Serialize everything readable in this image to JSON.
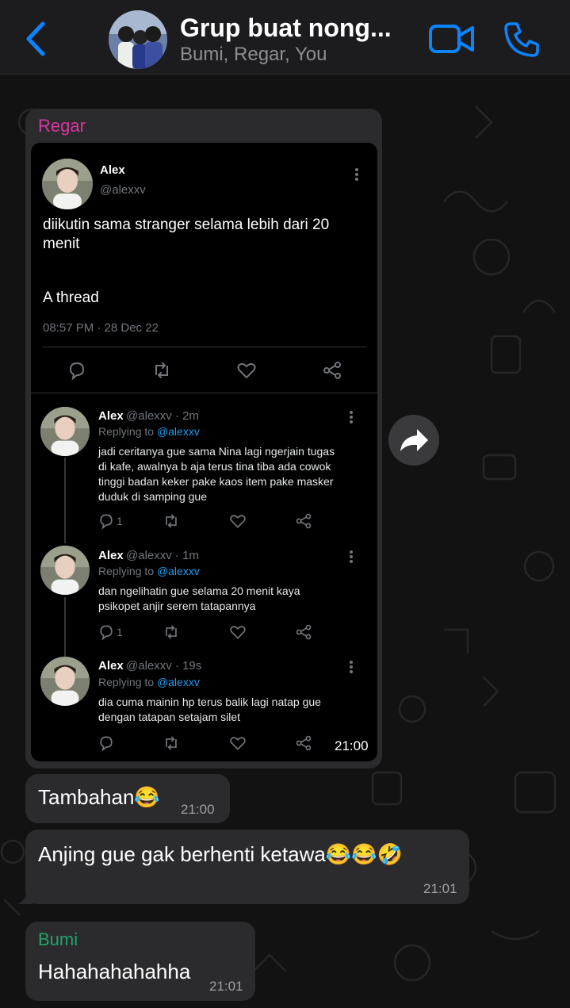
{
  "header": {
    "back_icon": "chevron-left-icon",
    "title": "Grup buat nong...",
    "members": "Bumi, Regar, You",
    "video_icon": "video-camera-icon",
    "call_icon": "phone-icon",
    "accent": "#0a84ff"
  },
  "messages": {
    "regar_tweet": {
      "sender": "Regar",
      "sender_color": "#d6389e",
      "time": "21:00",
      "tweet": {
        "name": "Alex",
        "handle": "@alexxv",
        "text": "diikutin sama stranger selama lebih dari 20 menit",
        "thread": "A thread",
        "date": "08:57 PM · 28 Dec 22",
        "replies": [
          {
            "name": "Alex",
            "meta": "@alexxv · 2m",
            "replying_label": "Replying to",
            "replying_handle": "@alexxv",
            "text": "jadi ceritanya gue sama Nina lagi ngerjain tugas di kafe, awalnya b aja terus tina tiba ada cowok tinggi badan keker pake kaos item pake masker duduk di samping gue",
            "reply_count": "1"
          },
          {
            "name": "Alex",
            "meta": "@alexxv · 1m",
            "replying_label": "Replying to",
            "replying_handle": "@alexxv",
            "text": "dan ngelihatin gue selama 20 menit kaya psikopet anjir serem tatapannya",
            "reply_count": "1"
          },
          {
            "name": "Alex",
            "meta": "@alexxv · 19s",
            "replying_label": "Replying to",
            "replying_handle": "@alexxv",
            "text": "dia cuma mainin hp terus balik lagi natap gue dengan tatapan setajam silet",
            "reply_count": ""
          }
        ]
      }
    },
    "tambahan": {
      "text": "Tambahan😂",
      "time": "21:00"
    },
    "anjing": {
      "text": "Anjing gue gak berhenti ketawa😂😂🤣",
      "time": "21:01"
    },
    "bumi": {
      "sender": "Bumi",
      "sender_color": "#25a36a",
      "text": "Hahahahahahha",
      "time": "21:01"
    }
  },
  "icons": {
    "forward": "forward-arrow-icon",
    "reply": "reply-bubble-icon",
    "retweet": "retweet-icon",
    "like": "heart-icon",
    "share": "share-icon",
    "more": "more-vertical-icon"
  }
}
